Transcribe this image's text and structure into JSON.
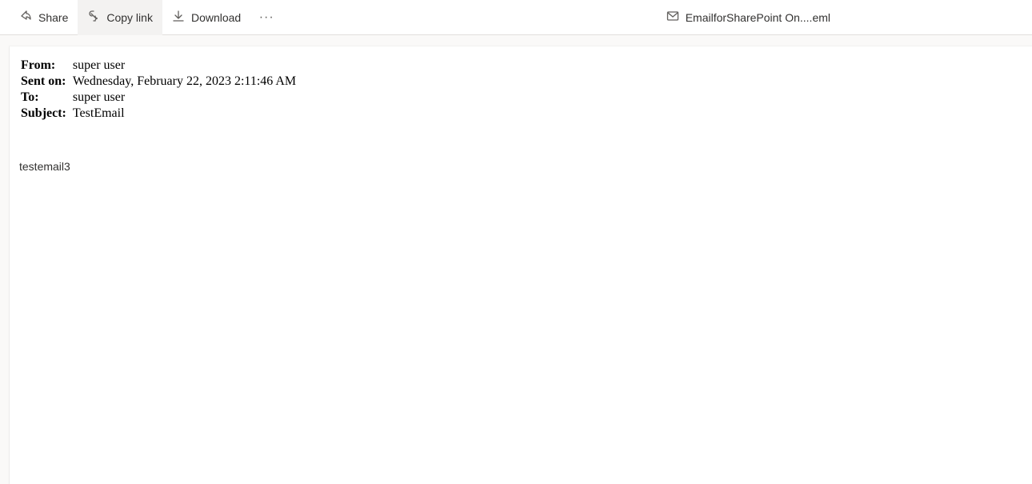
{
  "toolbar": {
    "share_label": "Share",
    "copy_link_label": "Copy link",
    "download_label": "Download"
  },
  "file": {
    "name": "EmailforSharePoint On....eml"
  },
  "email": {
    "headers": {
      "from_label": "From:",
      "from_value": "super user",
      "sent_on_label": "Sent on:",
      "sent_on_value": "Wednesday, February 22, 2023 2:11:46 AM",
      "to_label": "To:",
      "to_value": "super user",
      "subject_label": "Subject:",
      "subject_value": "TestEmail"
    },
    "body": "testemail3"
  }
}
